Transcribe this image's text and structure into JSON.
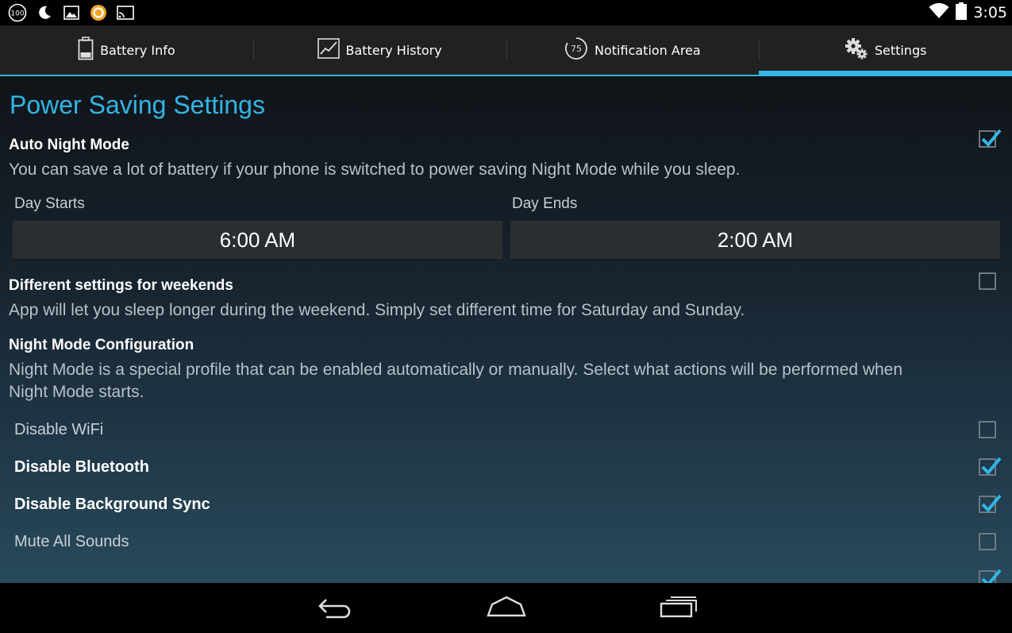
{
  "status_bar": {
    "battery_badge": "100",
    "time": "3:05",
    "icons": [
      "battery-100-icon",
      "moon-icon",
      "image-icon",
      "app-ring-icon",
      "cast-icon",
      "wifi-icon",
      "battery-icon"
    ]
  },
  "tabs": [
    {
      "label": "Battery Info",
      "icon": "battery-icon",
      "selected": false
    },
    {
      "label": "Battery History",
      "icon": "chart-icon",
      "selected": false
    },
    {
      "label": "Notification Area",
      "icon": "gauge-75-icon",
      "badge": "75",
      "selected": false
    },
    {
      "label": "Settings",
      "icon": "gears-icon",
      "selected": true
    }
  ],
  "settings": {
    "section_title": "Power Saving Settings",
    "auto_night_mode": {
      "title": "Auto Night Mode",
      "summary": "You can save a lot of battery if your phone is switched to power saving Night Mode while you sleep.",
      "checked": true
    },
    "day_starts": {
      "label": "Day Starts",
      "value": "6:00 AM"
    },
    "day_ends": {
      "label": "Day Ends",
      "value": "2:00 AM"
    },
    "weekends": {
      "title": "Different settings for weekends",
      "summary": "App will let you sleep longer during the weekend. Simply set different time for Saturday and Sunday.",
      "checked": false
    },
    "night_mode_config": {
      "title": "Night Mode Configuration",
      "summary": "Night Mode is a special profile that can be enabled automatically or manually. Select what actions will be performed when Night Mode starts."
    },
    "actions": [
      {
        "label": "Disable WiFi",
        "checked": false
      },
      {
        "label": "Disable Bluetooth",
        "checked": true
      },
      {
        "label": "Disable Background Sync",
        "checked": true
      },
      {
        "label": "Mute All Sounds",
        "checked": false
      }
    ]
  },
  "colors": {
    "accent": "#33b5e5",
    "tab_bar": "#212121",
    "checkbox_border": "#6f7a82"
  },
  "nav_bar": {
    "icons": [
      "back-icon",
      "home-icon",
      "recent-apps-icon"
    ]
  }
}
